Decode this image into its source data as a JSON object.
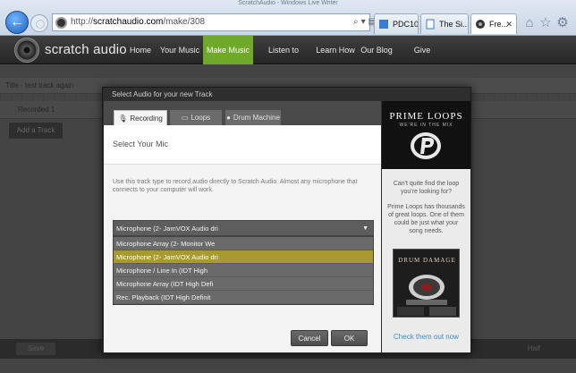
{
  "window": {
    "title": "ScratchAudio - Windows Live Writer"
  },
  "browser": {
    "url_prefix": "http://",
    "url_host": "scratchaudio.com",
    "url_path": "/make/308",
    "address_tools": [
      "⌕",
      "▾",
      "▤",
      "↻",
      "✕"
    ],
    "tabs": [
      {
        "label": "PDC10"
      },
      {
        "label": "The Si..."
      },
      {
        "label": "Fre..."
      }
    ],
    "accent": "#1f5fb8"
  },
  "site": {
    "logo": "scratch audio",
    "nav": [
      {
        "label": "Home",
        "active": false
      },
      {
        "label": "Your Music",
        "active": false
      },
      {
        "label": "Make Music",
        "active": true
      },
      {
        "label": "Listen to Music",
        "active": false
      },
      {
        "label": "Learn How",
        "active": false
      },
      {
        "label": "Our Blog",
        "active": false
      },
      {
        "label": "Give Feedback",
        "active": false
      }
    ],
    "accent": "#6fa92a"
  },
  "background": {
    "strip": "Title - test track again",
    "track": "Recorded 1",
    "add_track": "Add a Track",
    "save": "Save",
    "half": "Half"
  },
  "modal": {
    "title": "Select Audio for your new Track",
    "tabs": [
      {
        "label": "Recording",
        "icon": "microphone-icon",
        "active": true
      },
      {
        "label": "Loops",
        "icon": "loops-icon",
        "active": false
      },
      {
        "label": "Drum Machine",
        "icon": "drum-icon",
        "active": false
      }
    ],
    "heading": "Select Your Mic",
    "description": "Use this track type to record audio directly to Scratch Audio. Almost any microphone that connects to your computer will work.",
    "select": {
      "value": "Microphone (2- JamVOX Audio dri",
      "options": [
        {
          "label": "Microphone Array (2- Monitor We",
          "selected": false
        },
        {
          "label": "Microphone (2- JamVOX Audio dri",
          "selected": true
        },
        {
          "label": "Microphone / Line In (IDT High",
          "selected": false
        },
        {
          "label": "Microphone Array (IDT High Defi",
          "selected": false
        },
        {
          "label": "Rec. Playback (IDT High Definit",
          "selected": false
        }
      ],
      "highlight_color": "#a89a2e"
    },
    "buttons": {
      "cancel": "Cancel",
      "ok": "OK"
    }
  },
  "promo": {
    "brand": "PRIME LOOPS",
    "tagline": "WE'RE IN THE MIX",
    "question": "Can't quite find the loop you're looking for?",
    "body": "Prime Loops has thousands of great loops. One of them could be just what your song needs.",
    "product": "DRUM DAMAGE",
    "link": "Check them out now",
    "link_color": "#3a8ec9"
  }
}
